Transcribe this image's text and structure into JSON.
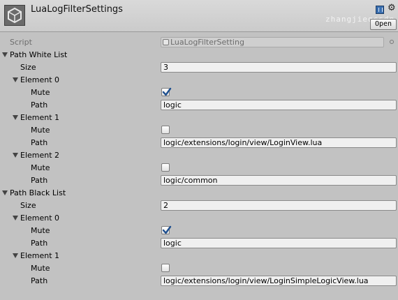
{
  "header": {
    "title": "LuaLogFilterSettings",
    "watermark": "zhangjieqcsdn",
    "open_label": "Open"
  },
  "script": {
    "label": "Script",
    "value": "LuaLogFilterSetting"
  },
  "white_list": {
    "label": "Path White List",
    "size_label": "Size",
    "size_value": "3",
    "elements": [
      {
        "label": "Element 0",
        "mute_label": "Mute",
        "mute": true,
        "path_label": "Path",
        "path": "logic"
      },
      {
        "label": "Element 1",
        "mute_label": "Mute",
        "mute": false,
        "path_label": "Path",
        "path": "logic/extensions/login/view/LoginView.lua"
      },
      {
        "label": "Element 2",
        "mute_label": "Mute",
        "mute": false,
        "path_label": "Path",
        "path": "logic/common"
      }
    ]
  },
  "black_list": {
    "label": "Path Black List",
    "size_label": "Size",
    "size_value": "2",
    "elements": [
      {
        "label": "Element 0",
        "mute_label": "Mute",
        "mute": true,
        "path_label": "Path",
        "path": "logic"
      },
      {
        "label": "Element 1",
        "mute_label": "Mute",
        "mute": false,
        "path_label": "Path",
        "path": "logic/extensions/login/view/LoginSimpleLogicView.lua"
      }
    ]
  },
  "icons": {
    "logo": "unity-logo-icon",
    "help": "book-help-icon",
    "settings": "gear-icon",
    "foldout": "triangle-down-icon",
    "check": "checkmark-icon",
    "object_picker": "object-picker-icon"
  },
  "colors": {
    "background": "#c2c2c2",
    "field": "#f0f0f0",
    "checkmark": "#1e4f8f"
  }
}
